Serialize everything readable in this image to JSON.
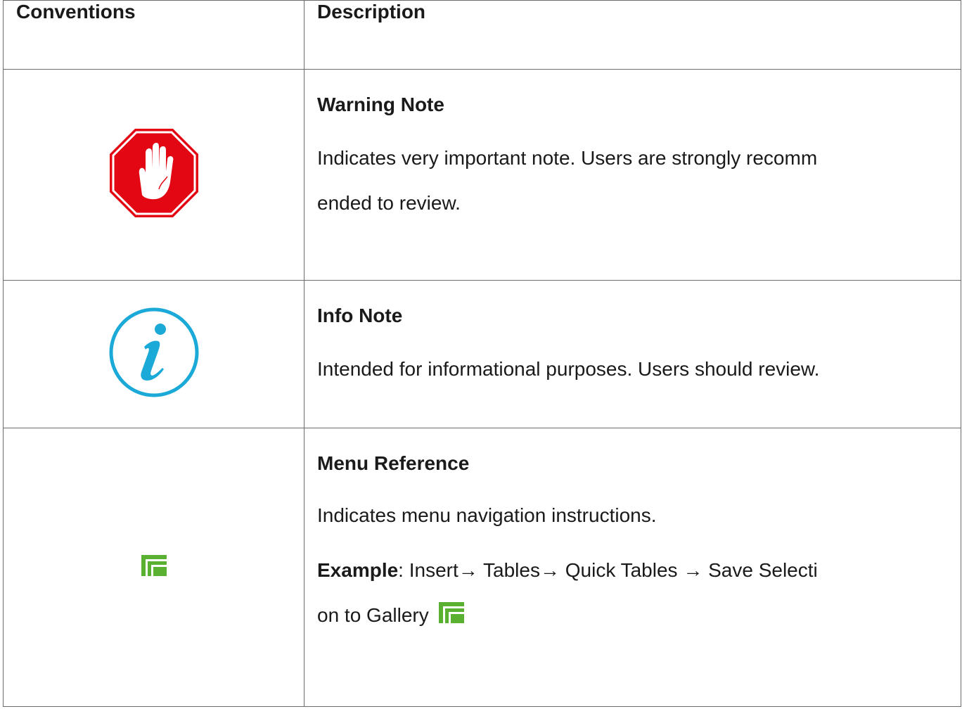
{
  "table": {
    "headers": [
      "Conventions",
      "Description"
    ],
    "rows": [
      {
        "icon": "stop-hand-icon",
        "title": "Warning Note",
        "text_line1": "Indicates very important note. Users are strongly recomm",
        "text_line2": "ended to review."
      },
      {
        "icon": "info-icon",
        "title": "Info Note",
        "text_line1": "Intended for informational purposes. Users should review."
      },
      {
        "icon": "menu-reference-icon",
        "title": "Menu Reference",
        "text_line1": "Indicates menu navigation instructions.",
        "example_label": "Example",
        "example_sep": ":",
        "example_line1": " Insert→ Tables→ Quick Tables → Save Selecti",
        "example_line2": "on to Gallery"
      }
    ]
  },
  "colors": {
    "warning_red": "#e30613",
    "info_blue": "#1ba9d8",
    "menu_green": "#59b031",
    "border": "#6b6b6b"
  }
}
